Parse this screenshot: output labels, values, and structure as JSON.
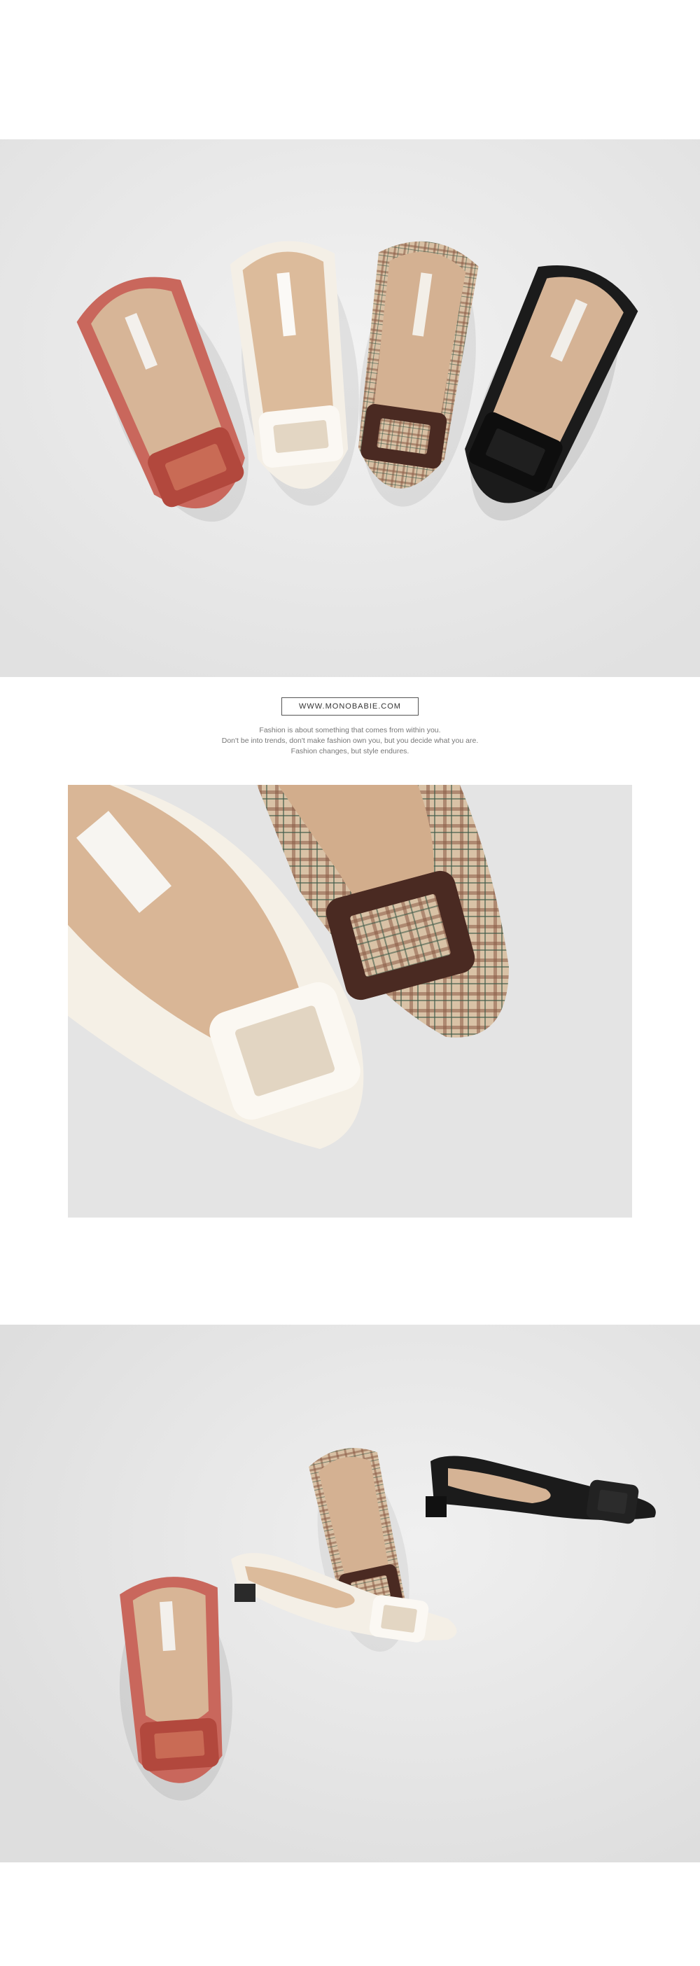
{
  "brand": {
    "url": "WWW.MONOBABIE.COM",
    "tagline": [
      "Fashion is about something that comes from within you.",
      "Don't be into trends, don't make fashion own you, but you decide what you are.",
      "Fashion changes, but style endures."
    ]
  },
  "colors": {
    "coral": "#c9675c",
    "ivory": "#f4efe6",
    "plaid_base": "#d9c3a8",
    "buckle_brown": "#4a2a22",
    "black": "#1b1b1b",
    "insole": "#d7b597"
  }
}
